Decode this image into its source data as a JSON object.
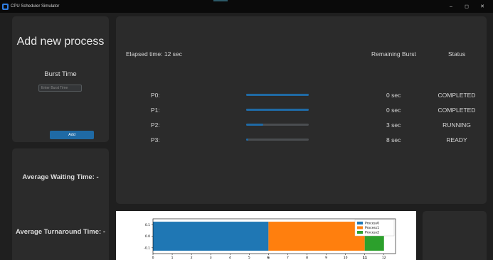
{
  "window": {
    "title": "CPU Scheduler Simulator",
    "minimize": "–",
    "maximize": "◻",
    "close": "✕"
  },
  "add_panel": {
    "title": "Add new process",
    "burst_label": "Burst Time",
    "burst_placeholder": "Enter Burst Time",
    "add_button": "Add"
  },
  "metrics": {
    "avg_waiting": "Average Waiting Time: -",
    "avg_turnaround": "Average Turnaround Time: -"
  },
  "process_panel": {
    "elapsed": "Elapsed time: 12 sec",
    "remaining_header": "Remaining Burst",
    "status_header": "Status",
    "processes": [
      {
        "name": "P0:",
        "progress": 1.0,
        "remaining": "0 sec",
        "status": "COMPLETED"
      },
      {
        "name": "P1:",
        "progress": 1.0,
        "remaining": "0 sec",
        "status": "COMPLETED"
      },
      {
        "name": "P2:",
        "progress": 0.27,
        "remaining": "3 sec",
        "status": "RUNNING"
      },
      {
        "name": "P3:",
        "progress": 0.02,
        "remaining": "8 sec",
        "status": "READY"
      }
    ]
  },
  "colors": {
    "accent": "#1f6aa5",
    "bg": "#1f1f1f",
    "panel": "#2b2b2b"
  },
  "chart_data": {
    "type": "bar",
    "orientation": "horizontal-stacked",
    "series": [
      {
        "name": "Process0",
        "start": 0,
        "end": 6,
        "color": "#1f77b4"
      },
      {
        "name": "Process1",
        "start": 6,
        "end": 11,
        "color": "#ff7f0e"
      },
      {
        "name": "Process2",
        "start": 11,
        "end": 12,
        "color": "#2ca02c"
      }
    ],
    "xlim": [
      0,
      12.6
    ],
    "ylim": [
      -0.15,
      0.15
    ],
    "xticks": [
      0,
      1,
      2,
      3,
      4,
      5,
      6,
      7,
      8,
      9,
      10,
      11,
      12
    ],
    "yticks": [
      "0.1",
      "0.0",
      "-0.1"
    ],
    "yvalues": [
      0.1,
      0.0,
      -0.1
    ],
    "extra_ticks": [
      6,
      11
    ],
    "legend": "top-right"
  }
}
